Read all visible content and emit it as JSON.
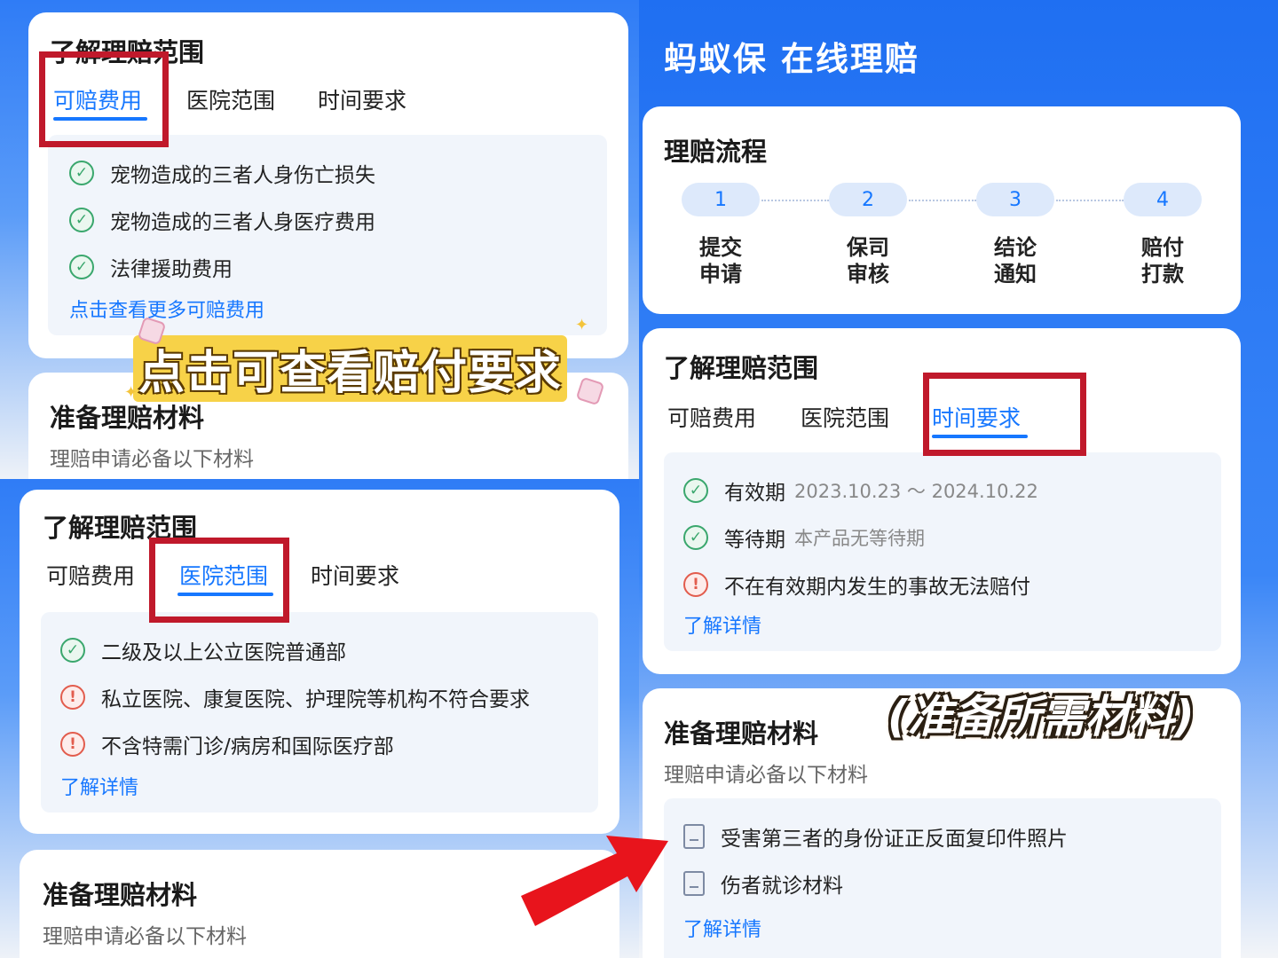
{
  "banner": {
    "title": "蚂蚁保 在线理赔"
  },
  "process": {
    "title": "理赔流程",
    "steps": [
      {
        "num": "1",
        "line1": "提交",
        "line2": "申请"
      },
      {
        "num": "2",
        "line1": "保司",
        "line2": "审核"
      },
      {
        "num": "3",
        "line1": "结论",
        "line2": "通知"
      },
      {
        "num": "4",
        "line1": "赔付",
        "line2": "打款"
      }
    ]
  },
  "tabs": {
    "fees": "可赔费用",
    "hospital": "医院范围",
    "time": "时间要求"
  },
  "scope_title": "了解理赔范围",
  "panel_fees": {
    "items": [
      "宠物造成的三者人身伤亡损失",
      "宠物造成的三者人身医疗费用",
      "法律援助费用"
    ],
    "link": "点击查看更多可赔费用"
  },
  "panel_hospital": {
    "items": [
      {
        "status": "ok",
        "text": "二级及以上公立医院普通部"
      },
      {
        "status": "warn",
        "text": "私立医院、康复医院、护理院等机构不符合要求"
      },
      {
        "status": "warn",
        "text": "不含特需门诊/病房和国际医疗部"
      }
    ],
    "link": "了解详情"
  },
  "panel_time": {
    "items": [
      {
        "status": "ok",
        "label": "有效期",
        "detail": "2023.10.23 ～ 2024.10.22"
      },
      {
        "status": "ok",
        "label": "等待期",
        "detail": "本产品无等待期"
      },
      {
        "status": "warn",
        "label": "不在有效期内发生的事故无法赔付",
        "detail": ""
      }
    ],
    "link": "了解详情"
  },
  "materials": {
    "title": "准备理赔材料",
    "subtitle": "理赔申请必备以下材料",
    "items": [
      "受害第三者的身份证正反面复印件照片",
      "伤者就诊材料"
    ],
    "link": "了解详情"
  },
  "stickers": {
    "left": "点击可查看赔付要求",
    "right": "(准备所需材料)"
  },
  "colors": {
    "accent": "#1677ff",
    "highlight_box": "#c0192b",
    "ok": "#3aa76d",
    "warn": "#e25c4d"
  }
}
